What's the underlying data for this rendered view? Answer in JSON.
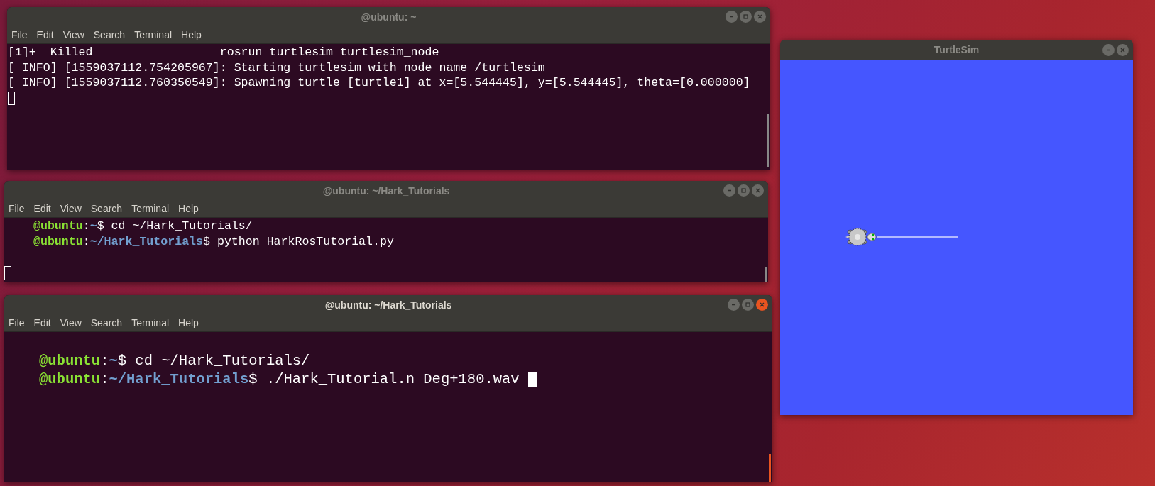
{
  "terminals": [
    {
      "title": "@ubuntu: ~",
      "focused": false,
      "menu": [
        "File",
        "Edit",
        "View",
        "Search",
        "Terminal",
        "Help"
      ],
      "lines": [
        {
          "kind": "output",
          "text": "[1]+  Killed                  rosrun turtlesim turtlesim_node"
        },
        {
          "kind": "output",
          "text": "[ INFO] [1559037112.754205967]: Starting turtlesim with node name /turtlesim"
        },
        {
          "kind": "output",
          "text": "[ INFO] [1559037112.760350549]: Spawning turtle [turtle1] at x=[5.544445], y=[5.544445], theta=[0.000000]"
        },
        {
          "kind": "cursor"
        }
      ]
    },
    {
      "title": "@ubuntu: ~/Hark_Tutorials",
      "focused": false,
      "menu": [
        "File",
        "Edit",
        "View",
        "Search",
        "Terminal",
        "Help"
      ],
      "lines": [
        {
          "kind": "prompt",
          "host": "@ubuntu",
          "sep": ":",
          "path": "~",
          "command": "$ cd ~/Hark_Tutorials/"
        },
        {
          "kind": "prompt",
          "host": "@ubuntu",
          "sep": ":",
          "path": "~/Hark_Tutorials",
          "command": "$ python HarkRosTutorial.py"
        },
        {
          "kind": "blank"
        },
        {
          "kind": "cursor"
        }
      ]
    },
    {
      "title": "@ubuntu: ~/Hark_Tutorials",
      "focused": true,
      "menu": [
        "File",
        "Edit",
        "View",
        "Search",
        "Terminal",
        "Help"
      ],
      "lines": [
        {
          "kind": "blank"
        },
        {
          "kind": "prompt",
          "host": "@ubuntu",
          "sep": ":",
          "path": "~",
          "command": "$ cd ~/Hark_Tutorials/"
        },
        {
          "kind": "prompt",
          "host": "@ubuntu",
          "sep": ":",
          "path": "~/Hark_Tutorials",
          "command": "$ ./Hark_Tutorial.n Deg+180.wav ",
          "cursor": true
        }
      ]
    }
  ],
  "turtlesim": {
    "title": "TurtleSim"
  }
}
